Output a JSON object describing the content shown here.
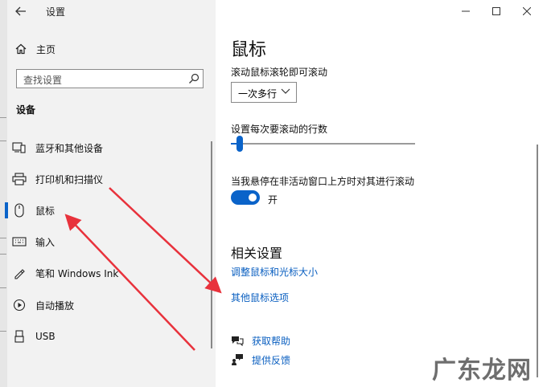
{
  "window": {
    "title": "设置",
    "controls": [
      "minimize",
      "maximize",
      "close"
    ]
  },
  "sidebar": {
    "home_label": "主页",
    "search_placeholder": "查找设置",
    "section_title": "设备",
    "items": [
      {
        "label": "蓝牙和其他设备",
        "icon": "devices-icon"
      },
      {
        "label": "打印机和扫描仪",
        "icon": "printer-icon"
      },
      {
        "label": "鼠标",
        "icon": "mouse-icon",
        "selected": true
      },
      {
        "label": "输入",
        "icon": "keyboard-icon"
      },
      {
        "label": "笔和 Windows Ink",
        "icon": "pen-icon"
      },
      {
        "label": "自动播放",
        "icon": "autoplay-icon"
      },
      {
        "label": "USB",
        "icon": "usb-icon"
      }
    ]
  },
  "main": {
    "title": "鼠标",
    "scroll_label": "滚动鼠标滚轮即可滚动",
    "scroll_value": "一次多行",
    "lines_label": "设置每次要滚动的行数",
    "lines_slider_fraction": 0.05,
    "inactive_scroll_label": "当我悬停在非活动窗口上方时对其进行滚动",
    "toggle_state": "开",
    "related_title": "相关设置",
    "link_adjust": "调整鼠标和光标大小",
    "link_other": "其他鼠标选项",
    "help_label": "获取帮助",
    "feedback_label": "提供反馈"
  },
  "watermark": "广东龙网",
  "colors": {
    "accent": "#0a63c9",
    "link": "#0a5fc0",
    "annotation": "#e8323c"
  }
}
